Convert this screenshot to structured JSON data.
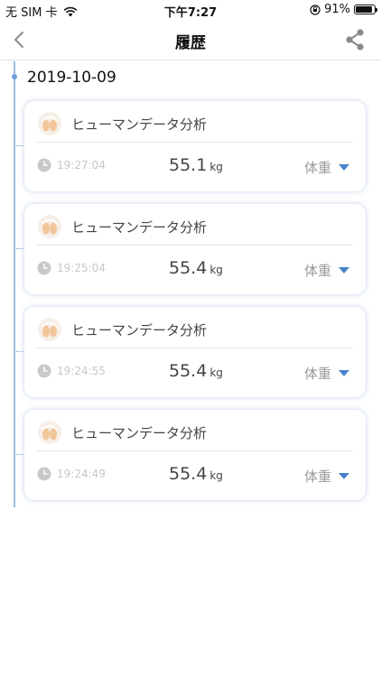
{
  "status_bar": {
    "carrier": "无 SIM 卡",
    "time": "下午7:27",
    "battery": "91%",
    "battery_level": 0.91
  },
  "nav": {
    "title": "履歴",
    "back_icon": "chevron-left-icon",
    "share_icon": "share-icon"
  },
  "timeline": {
    "date": "2019-10-09"
  },
  "records": [
    {
      "title": "ヒューマンデータ分析",
      "time": "19:27:04",
      "value": "55.1",
      "unit": "kg",
      "metric": "体重"
    },
    {
      "title": "ヒューマンデータ分析",
      "time": "19:25:04",
      "value": "55.4",
      "unit": "kg",
      "metric": "体重"
    },
    {
      "title": "ヒューマンデータ分析",
      "time": "19:24:55",
      "value": "55.4",
      "unit": "kg",
      "metric": "体重"
    },
    {
      "title": "ヒューマンデータ分析",
      "time": "19:24:49",
      "value": "55.4",
      "unit": "kg",
      "metric": "体重"
    }
  ],
  "colors": {
    "accent": "#4a83cc",
    "timeline": "#9bbbe0",
    "icon_skin": "#f2c69a"
  }
}
